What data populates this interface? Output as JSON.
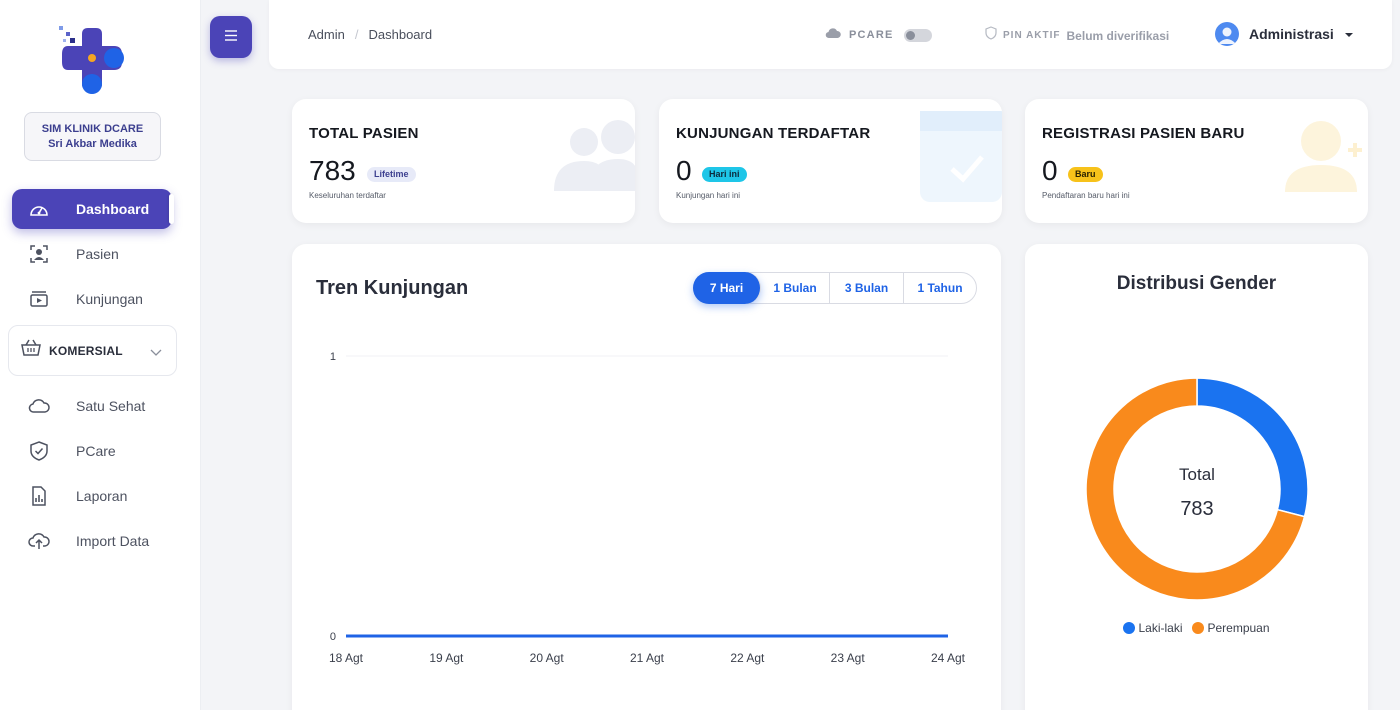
{
  "sidebar": {
    "clinic_line1": "SIM KLINIK DCARE",
    "clinic_line2": "Sri Akbar Medika",
    "items": [
      {
        "label": "Dashboard",
        "icon": "gauge-icon"
      },
      {
        "label": "Pasien",
        "icon": "patient-icon"
      },
      {
        "label": "Kunjungan",
        "icon": "visit-icon"
      },
      {
        "label": "Satu Sehat",
        "icon": "cloud-icon"
      },
      {
        "label": "PCare",
        "icon": "shield-icon"
      },
      {
        "label": "Laporan",
        "icon": "report-icon"
      },
      {
        "label": "Import Data",
        "icon": "upload-icon"
      }
    ],
    "section_label": "KOMERSIAL"
  },
  "topbar": {
    "breadcrumb": [
      "Admin",
      "Dashboard"
    ],
    "pcare_label": "PCARE",
    "pin_label": "PIN AKTIF",
    "pin_status": "Belum diverifikasi",
    "user_name": "Administrasi"
  },
  "stats": [
    {
      "title": "TOTAL PASIEN",
      "value": "783",
      "badge": "Lifetime",
      "sub": "Keseluruhan terdaftar"
    },
    {
      "title": "KUNJUNGAN TERDAFTAR",
      "value": "0",
      "badge": "Hari ini",
      "sub": "Kunjungan hari ini"
    },
    {
      "title": "REGISTRASI PASIEN BARU",
      "value": "0",
      "badge": "Baru",
      "sub": "Pendaftaran baru hari ini"
    }
  ],
  "chart_section": {
    "title": "Tren Kunjungan",
    "ranges": [
      "7 Hari",
      "1 Bulan",
      "3 Bulan",
      "1 Tahun"
    ],
    "active_range": "7 Hari"
  },
  "chart_data": [
    {
      "type": "line",
      "x": [
        "18 Agt",
        "19 Agt",
        "20 Agt",
        "21 Agt",
        "22 Agt",
        "23 Agt",
        "24 Agt"
      ],
      "series": [
        {
          "values": [
            0,
            0,
            0,
            0,
            0,
            0,
            0
          ]
        }
      ],
      "y_ticks": [
        "0",
        "1"
      ],
      "ylim": [
        0,
        1
      ],
      "color": "#1f63e6",
      "grid": true
    },
    {
      "type": "pie",
      "title": "Distribusi Gender",
      "categories": [
        "Laki-laki",
        "Perempuan"
      ],
      "values": [
        0.29,
        0.71
      ],
      "colors": [
        "#1a73f0",
        "#f98a1c"
      ],
      "center_label": "Total",
      "center_value": "783",
      "legend": "bottom"
    }
  ]
}
